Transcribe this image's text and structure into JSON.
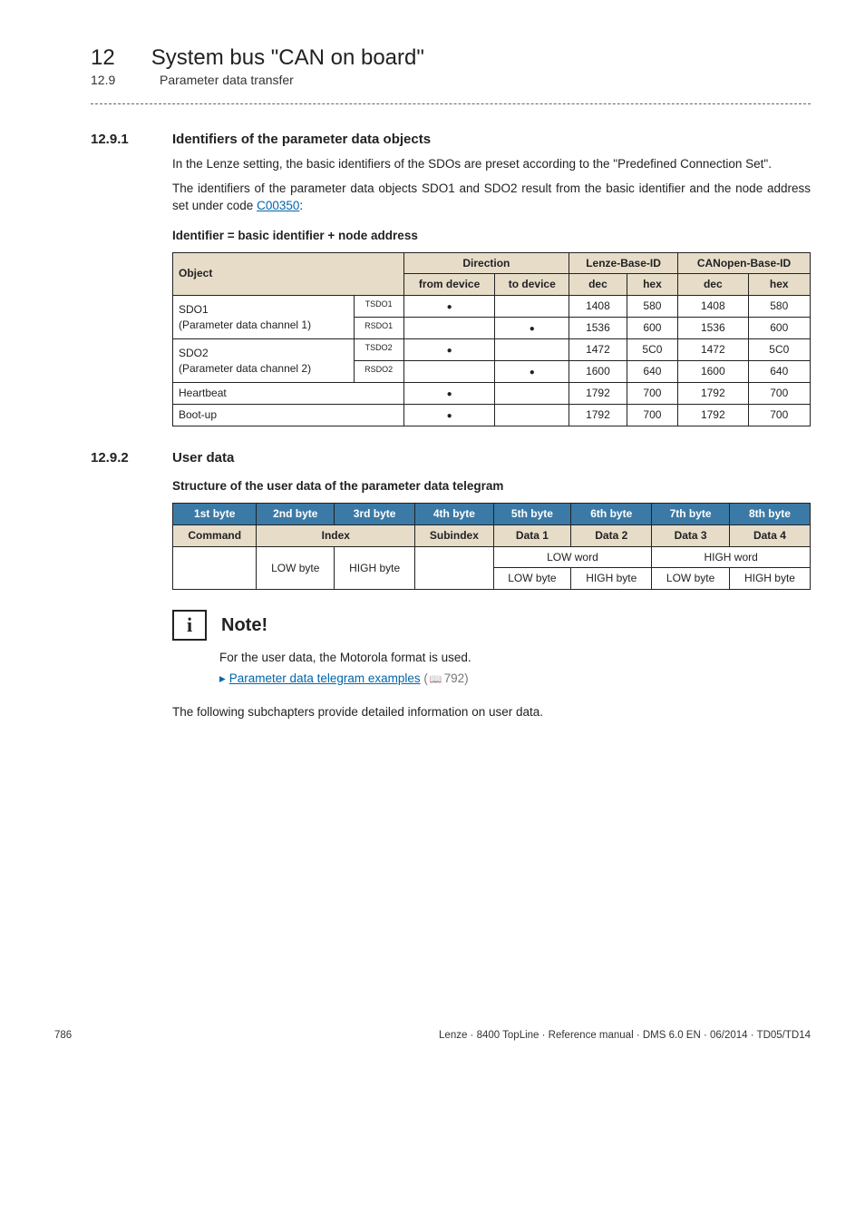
{
  "header": {
    "chapter_num": "12",
    "chapter_title": "System bus \"CAN on board\"",
    "sub_num": "12.9",
    "sub_title": "Parameter data transfer"
  },
  "sec1": {
    "num": "12.9.1",
    "title": "Identifiers of the parameter data objects",
    "p1": "In the Lenze setting, the basic identifiers of the SDOs are preset according to the \"Predefined Connection Set\".",
    "p2a": "The identifiers of the parameter data objects SDO1 and SDO2 result from the basic identifier and the node address set under code ",
    "p2_link": "C00350",
    "p2b": ":",
    "formula": "Identifier = basic identifier + node address"
  },
  "table1": {
    "hdr": {
      "object": "Object",
      "direction": "Direction",
      "lenze": "Lenze-Base-ID",
      "canopen": "CANopen-Base-ID",
      "from": "from device",
      "to": "to device",
      "dec": "dec",
      "hex": "hex"
    },
    "rows": [
      {
        "obj_main": "SDO1",
        "obj_sub": "(Parameter data channel 1)",
        "sup": "TSDO1",
        "from": true,
        "to": false,
        "ldec": "1408",
        "lhex": "580",
        "cdec": "1408",
        "chex": "580"
      },
      {
        "obj_main": "",
        "obj_sub": "",
        "sup": "RSDO1",
        "from": false,
        "to": true,
        "ldec": "1536",
        "lhex": "600",
        "cdec": "1536",
        "chex": "600"
      },
      {
        "obj_main": "SDO2",
        "obj_sub": "(Parameter data channel 2)",
        "sup": "TSDO2",
        "from": true,
        "to": false,
        "ldec": "1472",
        "lhex": "5C0",
        "cdec": "1472",
        "chex": "5C0"
      },
      {
        "obj_main": "",
        "obj_sub": "",
        "sup": "RSDO2",
        "from": false,
        "to": true,
        "ldec": "1600",
        "lhex": "640",
        "cdec": "1600",
        "chex": "640"
      },
      {
        "obj_main": "Heartbeat",
        "obj_sub": "",
        "sup": "",
        "from": true,
        "to": false,
        "ldec": "1792",
        "lhex": "700",
        "cdec": "1792",
        "chex": "700",
        "span": true
      },
      {
        "obj_main": "Boot-up",
        "obj_sub": "",
        "sup": "",
        "from": true,
        "to": false,
        "ldec": "1792",
        "lhex": "700",
        "cdec": "1792",
        "chex": "700",
        "span": true
      }
    ]
  },
  "sec2": {
    "num": "12.9.2",
    "title": "User data",
    "sub": "Structure of the user data of the parameter data telegram"
  },
  "table2": {
    "r1": [
      "1st byte",
      "2nd byte",
      "3rd byte",
      "4th byte",
      "5th byte",
      "6th byte",
      "7th byte",
      "8th byte"
    ],
    "r2": [
      "Command",
      "Index",
      "Subindex",
      "Data 1",
      "Data 2",
      "Data 3",
      "Data 4"
    ],
    "body": {
      "lowbyte1": "LOW byte",
      "highbyte_top": "HIGH byte",
      "lowword": "LOW word",
      "highword": "HIGH word",
      "lowbyte2": "LOW byte",
      "highbyte2": "HIGH byte",
      "lowbyte3": "LOW byte",
      "highbyte3": "HIGH byte"
    }
  },
  "note": {
    "title": "Note!",
    "line1": "For the user data, the Motorola format is used.",
    "link": "Parameter data telegram examples",
    "pageref": "792"
  },
  "closing": "The following subchapters provide detailed information on user data.",
  "footer": {
    "page": "786",
    "right": "Lenze · 8400 TopLine · Reference manual · DMS 6.0 EN · 06/2014 · TD05/TD14"
  }
}
